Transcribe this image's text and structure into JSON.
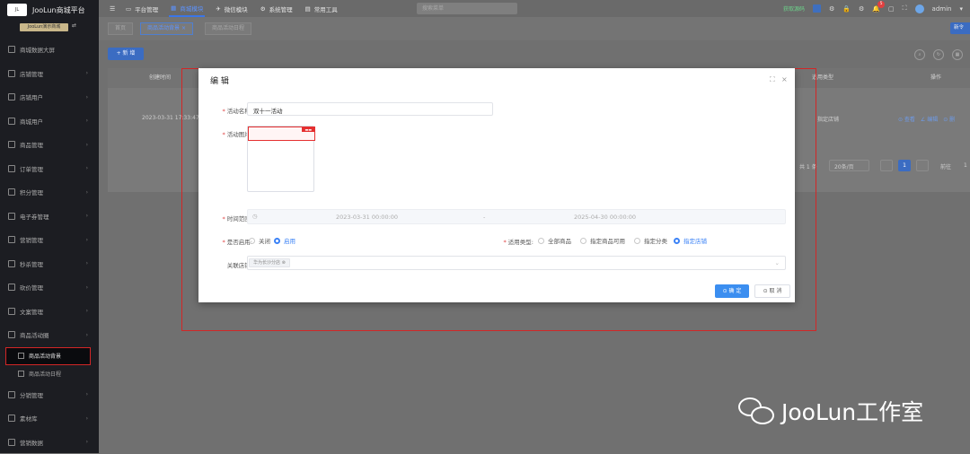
{
  "brand": {
    "title": "JooLun商城平台",
    "shop_chip": "JooLun演示商城"
  },
  "sidebar": {
    "items": [
      {
        "label": "商城数据大屏",
        "chev": false
      },
      {
        "label": "店铺管理",
        "chev": true
      },
      {
        "label": "店铺用户",
        "chev": true
      },
      {
        "label": "商城用户",
        "chev": true
      },
      {
        "label": "商品管理",
        "chev": true
      },
      {
        "label": "订单管理",
        "chev": true
      },
      {
        "label": "积分管理",
        "chev": true
      },
      {
        "label": "电子券管理",
        "chev": true
      },
      {
        "label": "营销管理",
        "chev": true
      },
      {
        "label": "秒杀管理",
        "chev": true
      },
      {
        "label": "砍价管理",
        "chev": true
      },
      {
        "label": "文案管理",
        "chev": true
      },
      {
        "label": "商品活动圈",
        "chev": true
      }
    ],
    "subitems": [
      "商品活动背景",
      "商品活动日程"
    ],
    "bottom_items": [
      "分销管理",
      "素材库",
      "营销数据"
    ]
  },
  "topnav": {
    "items": [
      "平台管理",
      "商城模块",
      "微信模块",
      "系统管理",
      "常用工具"
    ],
    "active": 1,
    "search_placeholder": "搜索菜单",
    "link": "获取源码",
    "badge": "5",
    "user": "admin"
  },
  "tabs": [
    "首页",
    "商品活动背景",
    "商品活动日程"
  ],
  "content": {
    "add_button": "+ 新 增",
    "right_button": "新令",
    "columns": {
      "created": "创建时间",
      "scope": "适用类型",
      "ops": "操作"
    },
    "row": {
      "created": "2023-03-31 17:33:47",
      "scope": "指定店铺",
      "ops": "⊙ 查看　∠ 编辑　⊙ 删"
    },
    "pager": {
      "total": "共 1 条",
      "size": "20条/页",
      "page": "1",
      "goto": "前往",
      "goto_val": "1"
    }
  },
  "dialog": {
    "title": "编 辑",
    "fields": {
      "name_label": "活动名称:",
      "name_value": "双十一活动",
      "image_label": "活动图片:",
      "time_label": "时间范围:",
      "time_start": "2023-03-31 00:00:00",
      "time_sep": "-",
      "time_end": "2025-04-30 00:00:00",
      "enable_label": "是否启用:",
      "enable_opts": [
        "关闭",
        "启用"
      ],
      "enable_selected": 1,
      "scope_label": "适用类型:",
      "scope_opts": [
        "全部商品",
        "指定商品可用",
        "指定分类",
        "指定店铺"
      ],
      "scope_selected": 3,
      "store_label": "关联店铺:",
      "store_tag": "华为长沙分店 ⊗"
    },
    "ok_label": "⊙ 确 定",
    "cancel_label": "⊙ 取 消"
  },
  "watermark": "JooLun工作室"
}
